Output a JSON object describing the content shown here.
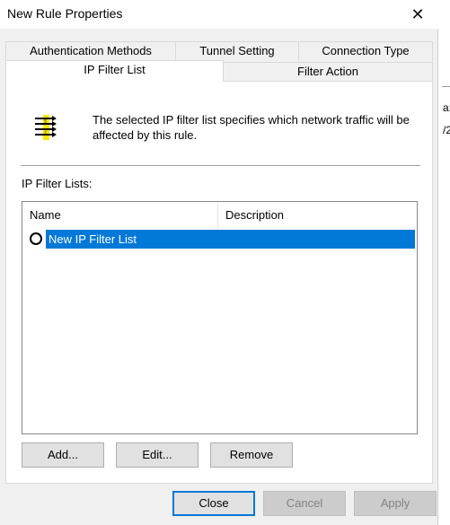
{
  "window": {
    "title": "New Rule Properties",
    "close_glyph": "✕"
  },
  "tabs": [
    {
      "label": "Authentication Methods",
      "active": false
    },
    {
      "label": "Tunnel Setting",
      "active": false
    },
    {
      "label": "Connection Type",
      "active": false
    },
    {
      "label": "IP Filter List",
      "active": true
    },
    {
      "label": "Filter Action",
      "active": false
    }
  ],
  "info": {
    "icon": "filter-list-icon",
    "text": "The selected IP filter list specifies which network traffic will be affected by this rule."
  },
  "filter_lists": {
    "label": "IP Filter Lists:",
    "columns": [
      "Name",
      "Description"
    ],
    "rows": [
      {
        "name": "New IP Filter List",
        "description": "",
        "selected": true,
        "radio_checked": false
      }
    ]
  },
  "list_buttons": {
    "add": "Add...",
    "edit": "Edit...",
    "remove": "Remove"
  },
  "dialog_buttons": {
    "close": "Close",
    "cancel": "Cancel",
    "apply": "Apply"
  },
  "background_fragments": [
    "a:",
    "/2"
  ],
  "colors": {
    "selection": "#0078d7",
    "icon_yellow": "#ffe600",
    "dialog_bg": "#f0f0f0"
  }
}
